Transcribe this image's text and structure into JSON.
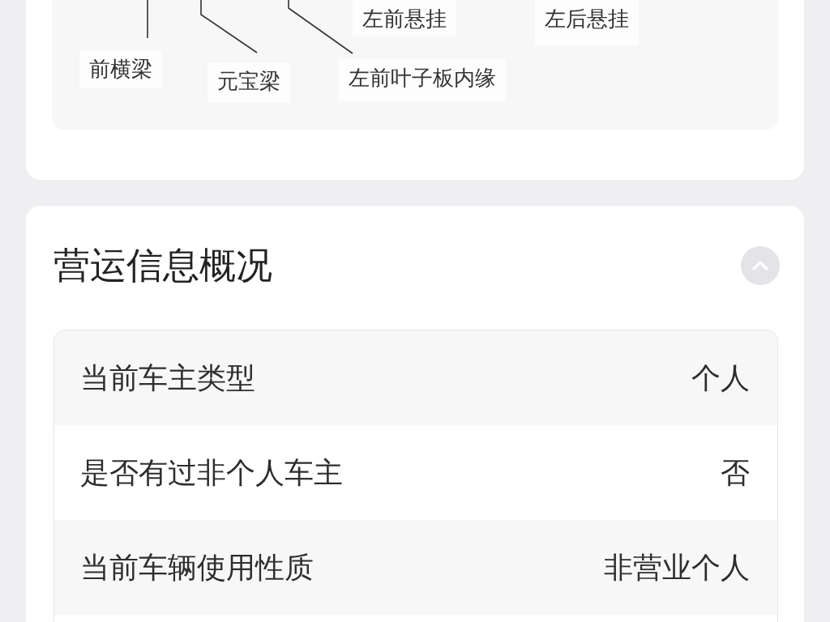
{
  "diagram": {
    "labels": [
      "左前悬挂",
      "左后悬挂",
      "前横梁",
      "元宝梁",
      "左前叶子板内缘"
    ]
  },
  "operation_info": {
    "title": "营运信息概况",
    "expanded": true,
    "rows": [
      {
        "label": "当前车主类型",
        "value": "个人"
      },
      {
        "label": "是否有过非个人车主",
        "value": "否"
      },
      {
        "label": "当前车辆使用性质",
        "value": "非营业个人"
      }
    ]
  }
}
